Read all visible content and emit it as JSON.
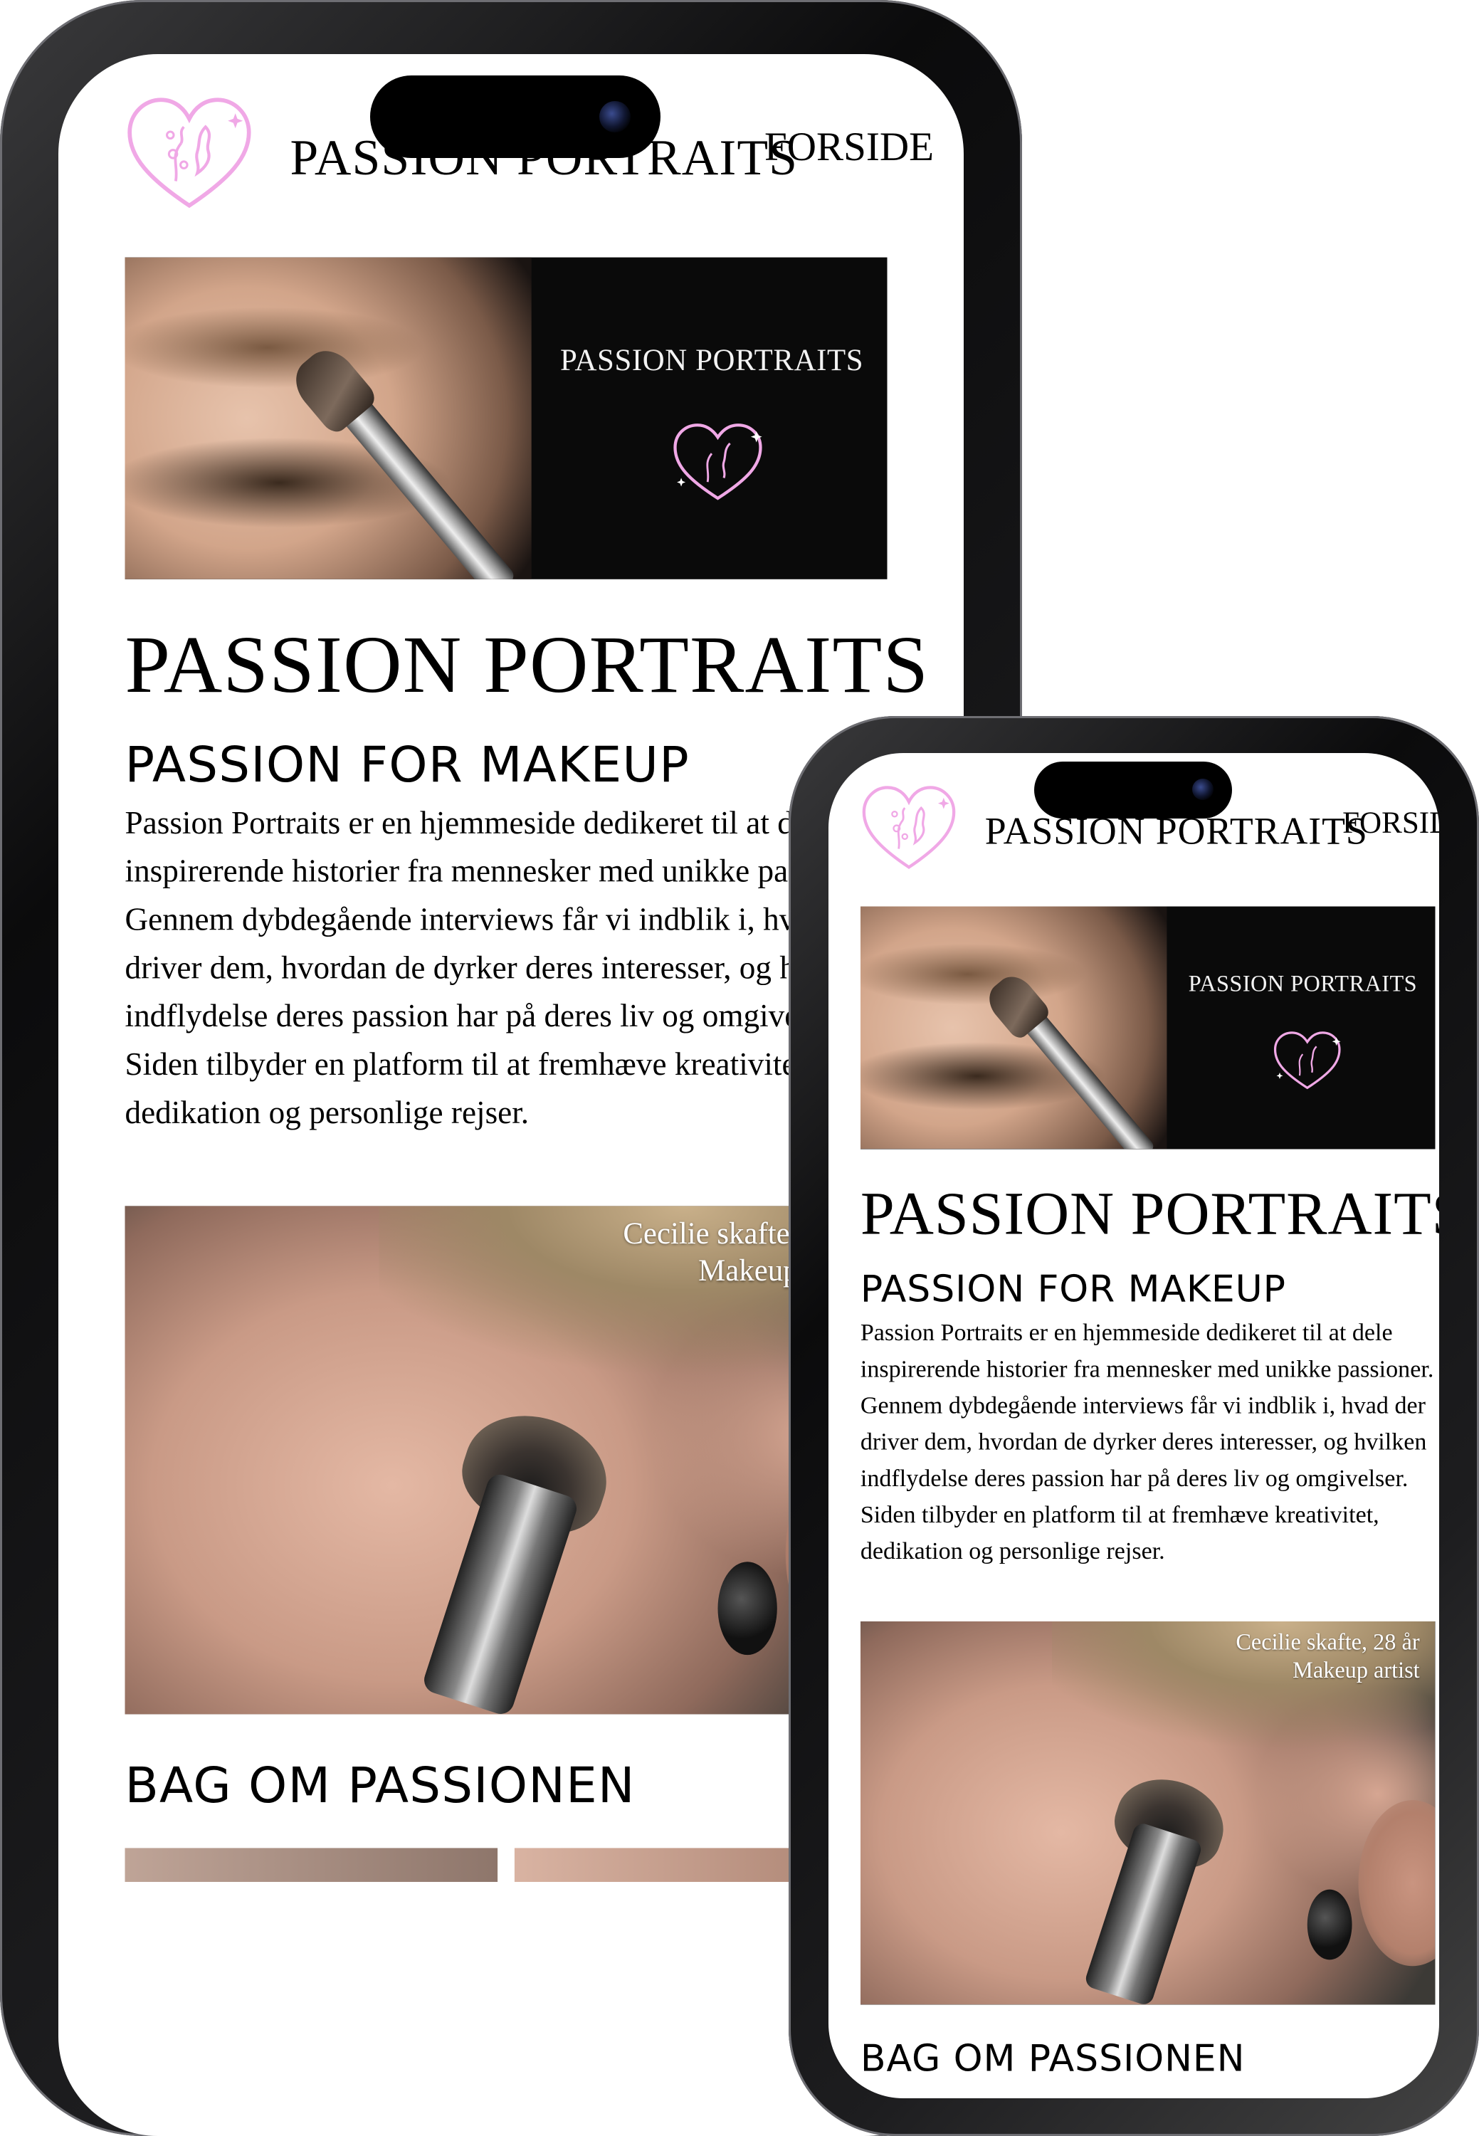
{
  "site": {
    "brand": "PASSION PORTRAITS",
    "nav_link": "FORSIDE"
  },
  "hero": {
    "overlay_title": "PASSION PORTRAITS"
  },
  "main": {
    "page_title": "PASSION PORTRAITS",
    "section_title": "PASSION FOR MAKEUP",
    "intro": "Passion Portraits er en hjemmeside dedikeret til at dele inspirerende historier fra mennesker med unikke passioner. Gennem dybdegående interviews får vi indblik i, hvad der driver dem, hvordan de dyrker deres interesser, og hvilken indflydelse deres passion har på deres liv og omgivelser. Siden tilbyder en platform til at fremhæve kreativitet, dedikation og personlige rejser.",
    "feature": {
      "caption_line1": "Cecilie skafte, 28 år",
      "caption_line2": "Makeup artist"
    },
    "section2_title": "BAG OM PASSIONEN"
  },
  "colors": {
    "logo_pink": "#f0a8e6",
    "page_bg": "#ffffff",
    "text": "#000000"
  }
}
